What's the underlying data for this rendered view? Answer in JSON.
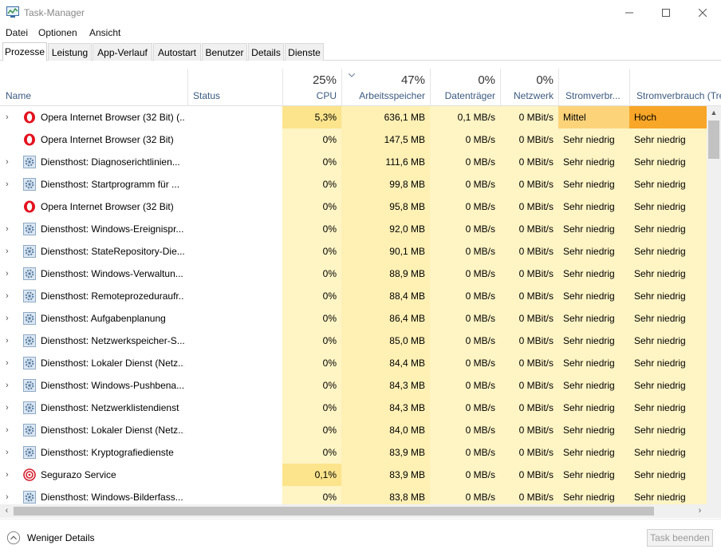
{
  "window": {
    "title": "Task-Manager"
  },
  "menu": [
    "Datei",
    "Optionen",
    "Ansicht"
  ],
  "tabs": [
    "Prozesse",
    "Leistung",
    "App-Verlauf",
    "Autostart",
    "Benutzer",
    "Details",
    "Dienste"
  ],
  "active_tab": "Prozesse",
  "header": {
    "name": "Name",
    "status": "Status",
    "cpu": {
      "pct": "25%",
      "label": "CPU"
    },
    "memory": {
      "pct": "47%",
      "label": "Arbeitsspeicher"
    },
    "disk": {
      "pct": "0%",
      "label": "Datenträger"
    },
    "network": {
      "pct": "0%",
      "label": "Netzwerk"
    },
    "power": {
      "label": "Stromverbr..."
    },
    "power_trend": {
      "label": "Stromverbrauch (Tre"
    }
  },
  "colors": {
    "heat_light": "#fff4c4",
    "heat_mid": "#fff0b4",
    "heat_cpu_active": "#fce48c",
    "power_mittel": "#fdd37a",
    "power_hoch": "#f8a628",
    "accent_header": "#3c5a80"
  },
  "rows": [
    {
      "name": "Opera Internet Browser (32 Bit) (...",
      "icon": "opera-icon",
      "expandable": true,
      "cpu": "5,3%",
      "mem": "636,1 MB",
      "disk": "0,1 MB/s",
      "net": "0 MBit/s",
      "power": "Mittel",
      "power_trend": "Hoch"
    },
    {
      "name": "Opera Internet Browser (32 Bit)",
      "icon": "opera-icon",
      "expandable": false,
      "cpu": "0%",
      "mem": "147,5 MB",
      "disk": "0 MB/s",
      "net": "0 MBit/s",
      "power": "Sehr niedrig",
      "power_trend": "Sehr niedrig"
    },
    {
      "name": "Diensthost: Diagnoserichtlinien...",
      "icon": "gear-icon",
      "expandable": true,
      "cpu": "0%",
      "mem": "111,6 MB",
      "disk": "0 MB/s",
      "net": "0 MBit/s",
      "power": "Sehr niedrig",
      "power_trend": "Sehr niedrig"
    },
    {
      "name": "Diensthost: Startprogramm für ...",
      "icon": "gear-icon",
      "expandable": true,
      "cpu": "0%",
      "mem": "99,8 MB",
      "disk": "0 MB/s",
      "net": "0 MBit/s",
      "power": "Sehr niedrig",
      "power_trend": "Sehr niedrig"
    },
    {
      "name": "Opera Internet Browser (32 Bit)",
      "icon": "opera-icon",
      "expandable": false,
      "cpu": "0%",
      "mem": "95,8 MB",
      "disk": "0 MB/s",
      "net": "0 MBit/s",
      "power": "Sehr niedrig",
      "power_trend": "Sehr niedrig"
    },
    {
      "name": "Diensthost: Windows-Ereignispr...",
      "icon": "gear-icon",
      "expandable": true,
      "cpu": "0%",
      "mem": "92,0 MB",
      "disk": "0 MB/s",
      "net": "0 MBit/s",
      "power": "Sehr niedrig",
      "power_trend": "Sehr niedrig"
    },
    {
      "name": "Diensthost: StateRepository-Die...",
      "icon": "gear-icon",
      "expandable": true,
      "cpu": "0%",
      "mem": "90,1 MB",
      "disk": "0 MB/s",
      "net": "0 MBit/s",
      "power": "Sehr niedrig",
      "power_trend": "Sehr niedrig"
    },
    {
      "name": "Diensthost: Windows-Verwaltun...",
      "icon": "gear-icon",
      "expandable": true,
      "cpu": "0%",
      "mem": "88,9 MB",
      "disk": "0 MB/s",
      "net": "0 MBit/s",
      "power": "Sehr niedrig",
      "power_trend": "Sehr niedrig"
    },
    {
      "name": "Diensthost: Remoteprozeduraufr...",
      "icon": "gear-icon",
      "expandable": true,
      "cpu": "0%",
      "mem": "88,4 MB",
      "disk": "0 MB/s",
      "net": "0 MBit/s",
      "power": "Sehr niedrig",
      "power_trend": "Sehr niedrig"
    },
    {
      "name": "Diensthost: Aufgabenplanung",
      "icon": "gear-icon",
      "expandable": true,
      "cpu": "0%",
      "mem": "86,4 MB",
      "disk": "0 MB/s",
      "net": "0 MBit/s",
      "power": "Sehr niedrig",
      "power_trend": "Sehr niedrig"
    },
    {
      "name": "Diensthost: Netzwerkspeicher-S...",
      "icon": "gear-icon",
      "expandable": true,
      "cpu": "0%",
      "mem": "85,0 MB",
      "disk": "0 MB/s",
      "net": "0 MBit/s",
      "power": "Sehr niedrig",
      "power_trend": "Sehr niedrig"
    },
    {
      "name": "Diensthost: Lokaler Dienst (Netz...",
      "icon": "gear-icon",
      "expandable": true,
      "cpu": "0%",
      "mem": "84,4 MB",
      "disk": "0 MB/s",
      "net": "0 MBit/s",
      "power": "Sehr niedrig",
      "power_trend": "Sehr niedrig"
    },
    {
      "name": "Diensthost: Windows-Pushbena...",
      "icon": "gear-icon",
      "expandable": true,
      "cpu": "0%",
      "mem": "84,3 MB",
      "disk": "0 MB/s",
      "net": "0 MBit/s",
      "power": "Sehr niedrig",
      "power_trend": "Sehr niedrig"
    },
    {
      "name": "Diensthost: Netzwerklistendienst",
      "icon": "gear-icon",
      "expandable": true,
      "cpu": "0%",
      "mem": "84,3 MB",
      "disk": "0 MB/s",
      "net": "0 MBit/s",
      "power": "Sehr niedrig",
      "power_trend": "Sehr niedrig"
    },
    {
      "name": "Diensthost: Lokaler Dienst (Netz...",
      "icon": "gear-icon",
      "expandable": true,
      "cpu": "0%",
      "mem": "84,0 MB",
      "disk": "0 MB/s",
      "net": "0 MBit/s",
      "power": "Sehr niedrig",
      "power_trend": "Sehr niedrig"
    },
    {
      "name": "Diensthost: Kryptografiedienste",
      "icon": "gear-icon",
      "expandable": true,
      "cpu": "0%",
      "mem": "83,9 MB",
      "disk": "0 MB/s",
      "net": "0 MBit/s",
      "power": "Sehr niedrig",
      "power_trend": "Sehr niedrig"
    },
    {
      "name": "Segurazo Service",
      "icon": "segurazo-icon",
      "expandable": true,
      "cpu": "0,1%",
      "mem": "83,9 MB",
      "disk": "0 MB/s",
      "net": "0 MBit/s",
      "power": "Sehr niedrig",
      "power_trend": "Sehr niedrig"
    },
    {
      "name": "Diensthost: Windows-Bilderfass...",
      "icon": "gear-icon",
      "expandable": true,
      "cpu": "0%",
      "mem": "83,8 MB",
      "disk": "0 MB/s",
      "net": "0 MBit/s",
      "power": "Sehr niedrig",
      "power_trend": "Sehr niedrig"
    }
  ],
  "footer": {
    "fewer_details": "Weniger Details",
    "end_task": "Task beenden"
  }
}
